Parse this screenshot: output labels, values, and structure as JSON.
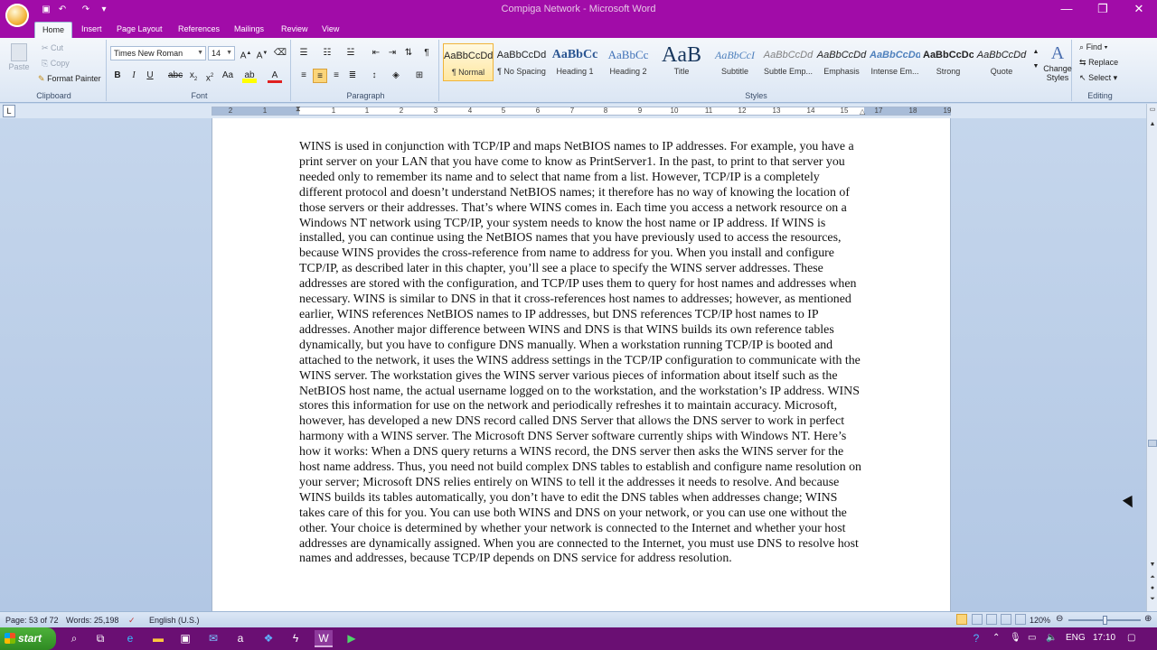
{
  "titlebar": {
    "title": "Compiga Network  -  Microsoft Word"
  },
  "tabs": [
    "Home",
    "Insert",
    "Page Layout",
    "References",
    "Mailings",
    "Review",
    "View"
  ],
  "clipboard": {
    "paste": "Paste",
    "cut": "Cut",
    "copy": "Copy",
    "format_painter": "Format Painter",
    "group": "Clipboard"
  },
  "font": {
    "name": "Times New Roman",
    "size": "14",
    "group": "Font"
  },
  "paragraph": {
    "group": "Paragraph"
  },
  "styles": {
    "group": "Styles",
    "items": [
      {
        "preview": "AaBbCcDd",
        "name": "¶ Normal"
      },
      {
        "preview": "AaBbCcDd",
        "name": "¶ No Spacing"
      },
      {
        "preview": "AaBbCc",
        "name": "Heading 1"
      },
      {
        "preview": "AaBbCc",
        "name": "Heading 2"
      },
      {
        "preview": "AaB",
        "name": "Title"
      },
      {
        "preview": "AaBbCcI",
        "name": "Subtitle"
      },
      {
        "preview": "AaBbCcDd",
        "name": "Subtle Emp..."
      },
      {
        "preview": "AaBbCcDd",
        "name": "Emphasis"
      },
      {
        "preview": "AaBbCcDd",
        "name": "Intense Em..."
      },
      {
        "preview": "AaBbCcDc",
        "name": "Strong"
      },
      {
        "preview": "AaBbCcDd",
        "name": "Quote"
      }
    ],
    "change_styles": "Change Styles"
  },
  "editing": {
    "find": "Find",
    "replace": "Replace",
    "select": "Select",
    "group": "Editing"
  },
  "ruler": {
    "ticks": [
      "2",
      "1",
      "1",
      "1",
      "2",
      "3",
      "4",
      "5",
      "6",
      "7",
      "8",
      "9",
      "10",
      "11",
      "12",
      "13",
      "14",
      "15",
      "16",
      "17",
      "18",
      "19"
    ]
  },
  "document": {
    "body": "WINS is used in conjunction with TCP/IP and maps NetBIOS names to IP addresses. For example, you have a print server on your LAN that you have come to know as PrintServer1. In the past, to print to that server you needed only to remember its name and to select that name from a list. However, TCP/IP is a completely different protocol and doesn’t understand NetBIOS names; it therefore has no way of knowing the location of those servers or their addresses. That’s where WINS comes in. Each time you access a network resource on a Windows NT network using TCP/IP, your system needs to know the host name or IP address. If WINS is installed, you can continue using the NetBIOS names that you have previously used to access the resources, because WINS provides the cross-reference from name to address for you. When you install and configure TCP/IP, as described later in this chapter, you’ll see a place to specify the WINS server addresses. These addresses are stored with the configuration, and TCP/IP uses them to query for host names and addresses when necessary. WINS is similar to DNS in that it cross-references host names to addresses; however, as mentioned earlier, WINS references NetBIOS names to IP addresses, but DNS references TCP/IP host names to IP addresses. Another major difference between WINS and DNS is that WINS builds its own reference tables dynamically, but you have to configure DNS manually. When a workstation running TCP/IP is booted and attached to the network, it uses the WINS address settings in the TCP/IP configuration to communicate with the WINS server. The workstation gives the WINS server various pieces of information about itself such as the NetBIOS host name, the actual username logged on to the workstation, and the workstation’s IP address. WINS stores this information for use on the network and periodically refreshes it to maintain accuracy. Microsoft, however, has developed a new DNS record called DNS Server that allows the DNS server to work in perfect harmony with a WINS server. The Microsoft DNS Server software currently ships with Windows NT. Here’s how it works: When a DNS query returns a WINS record, the DNS server then asks the WINS server for the host name address. Thus, you need not build complex DNS tables to establish and configure name resolution on your server; Microsoft DNS relies entirely on WINS to tell it the addresses it needs to resolve. And because WINS builds its tables automatically, you don’t have to edit the DNS tables when addresses change; WINS takes care of this for you. You can use both WINS and DNS on your network, or you can use one without the other. Your choice is determined by whether your network is connected to the Internet and whether your host addresses are dynamically assigned. When you are connected to the Internet, you must use DNS to resolve host names and addresses, because TCP/IP depends on DNS service for address resolution."
  },
  "status": {
    "page": "Page: 53 of 72",
    "words": "Words: 25,198",
    "language": "English (U.S.)",
    "zoom": "120%"
  },
  "taskbar": {
    "start": "start",
    "lang": "ENG",
    "time": "17:10"
  },
  "colors": {
    "titlebar": "#a10ca8",
    "taskbar": "#6a0f73",
    "start": "#3a9a2c"
  }
}
